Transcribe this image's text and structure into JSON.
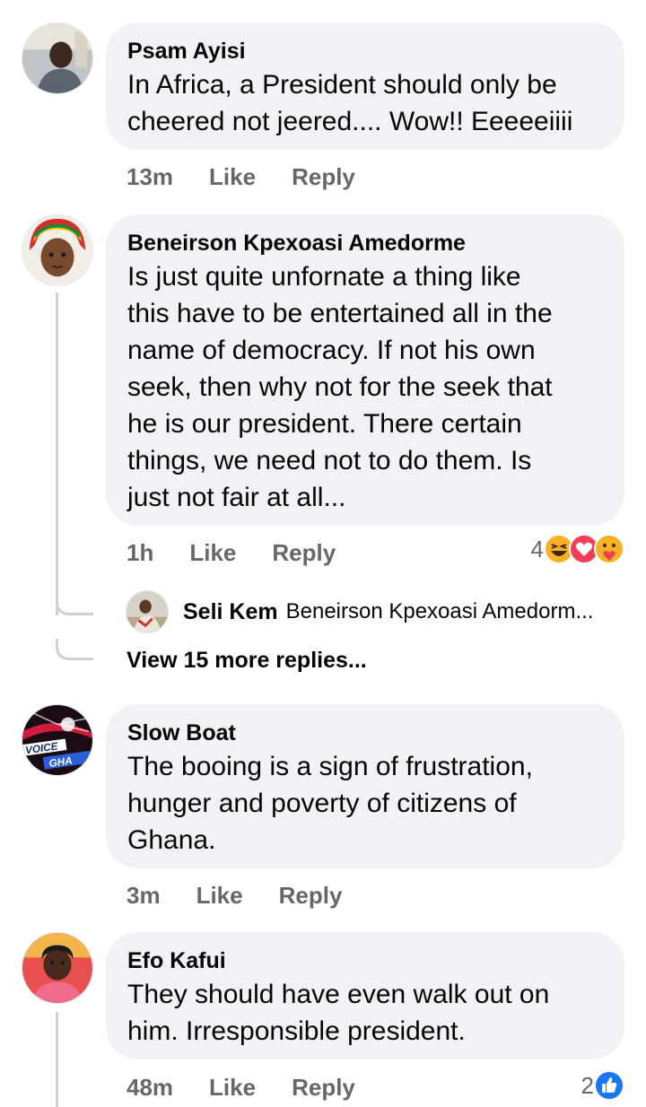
{
  "comments": [
    {
      "author": "Psam Ayisi",
      "text": "In Africa, a President should only be\ncheered not jeered.... Wow!! Eeeeeiiii",
      "time": "13m",
      "like_label": "Like",
      "reply_label": "Reply"
    },
    {
      "author": "Beneirson Kpexoasi Amedorme",
      "text": "Is just quite unfornate a thing like\nthis have to be entertained all in the\nname of democracy. If not his own\nseek, then why not for the seek that\nhe is our president. There certain\nthings, we need not to do them. Is\njust not fair at all...",
      "time": "1h",
      "like_label": "Like",
      "reply_label": "Reply",
      "reaction_count": "4",
      "reaction_icons": [
        "haha-icon",
        "love-icon",
        "care-icon"
      ],
      "reply_preview": {
        "author": "Seli Kem",
        "text": "Beneirson Kpexoasi Amedorm..."
      },
      "view_more_label": "View 15 more replies..."
    },
    {
      "author": "Slow Boat",
      "text": "The booing is a sign of frustration,\nhunger and poverty of citizens of\nGhana.",
      "time": "3m",
      "like_label": "Like",
      "reply_label": "Reply",
      "avatar_text": "VOICE GHA"
    },
    {
      "author": "Efo Kafui",
      "text": "They should have even walk out on\nhim. Irresponsible president.",
      "time": "48m",
      "like_label": "Like",
      "reply_label": "Reply",
      "reaction_count": "2",
      "reaction_icons": [
        "like-icon"
      ]
    }
  ],
  "colors": {
    "bubble": "#f0f2f5",
    "meta_text": "#65676b",
    "thread_line": "#ced0d4",
    "like_blue": "#1877f2",
    "love_red": "#f33e58",
    "haha_yellow": "#f7b125"
  }
}
